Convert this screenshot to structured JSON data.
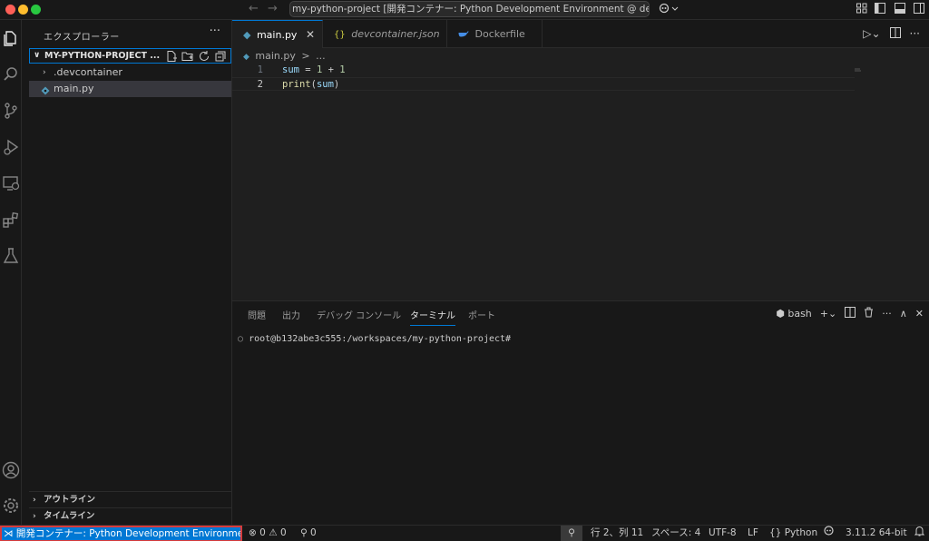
{
  "titlebar": {
    "command_center": "my-python-project [開発コンテナー: Python Development Environment @ desktop-lin"
  },
  "activity_bar": {
    "items": [
      "explorer-icon",
      "search-icon",
      "source-control-icon",
      "run-debug-icon",
      "remote-explorer-icon",
      "extensions-icon",
      "testing-icon"
    ],
    "bottom": [
      "account-icon",
      "settings-icon"
    ]
  },
  "sidebar": {
    "title": "エクスプローラー",
    "more": "···",
    "project": "MY-PYTHON-PROJECT ...",
    "tree": [
      {
        "label": ".devcontainer",
        "type": "folder"
      },
      {
        "label": "main.py",
        "type": "python",
        "selected": true
      }
    ],
    "outline": "アウトライン",
    "timeline": "タイムライン"
  },
  "tabs": [
    {
      "label": "main.py",
      "icon": "python",
      "active": true
    },
    {
      "label": "devcontainer.json",
      "icon": "json",
      "active": false,
      "prefix": "{}"
    },
    {
      "label": "Dockerfile",
      "icon": "docker",
      "active": false
    }
  ],
  "breadcrumb": {
    "file": "main.py",
    "sep": ">",
    "rest": "..."
  },
  "editor": {
    "lines": [
      {
        "number": "1",
        "text": "sum = 1 + 1"
      },
      {
        "number": "2",
        "text": "print(sum)"
      }
    ]
  },
  "panel": {
    "tabs": [
      "問題",
      "出力",
      "デバッグ コンソール",
      "ターミナル",
      "ポート"
    ],
    "active_tab": "ターミナル",
    "shell": "bash",
    "prompt": "root@b132abe3c555:/workspaces/my-python-project#"
  },
  "statusbar": {
    "remote": "開発コンテナー: Python Development Environment ...",
    "errors": "0",
    "warnings": "0",
    "ports": "0",
    "position": "行 2、列 11",
    "spaces": "スペース: 4",
    "encoding": "UTF-8",
    "eol": "LF",
    "language": "Python",
    "python_version": "3.11.2 64-bit"
  },
  "colors": {
    "accent": "#0078d4",
    "remote_border": "#d83b3b",
    "python_icon": "#519aba",
    "json_icon": "#cbcb41",
    "docker_icon": "#458ee6"
  }
}
